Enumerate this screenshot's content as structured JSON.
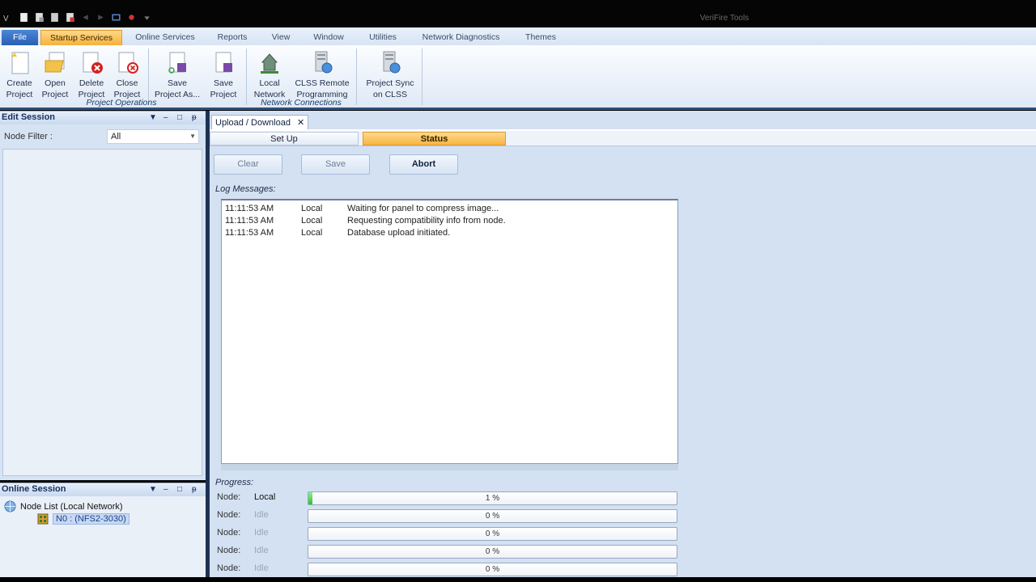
{
  "window": {
    "title": "VeriFire Tools"
  },
  "quick_access": [
    "app-logo-icon",
    "new-file-icon",
    "open-file-icon",
    "save-file-icon",
    "print-icon",
    "undo-icon",
    "redo-icon",
    "network-icon",
    "run-icon",
    "customize-icon"
  ],
  "ribbon_tabs": [
    {
      "label": "File",
      "active": false
    },
    {
      "label": "Startup Services",
      "active": true
    },
    {
      "label": "Online Services",
      "active": false
    },
    {
      "label": "Reports",
      "active": false
    },
    {
      "label": "View",
      "active": false
    },
    {
      "label": "Window",
      "active": false
    },
    {
      "label": "Utilities",
      "active": false
    },
    {
      "label": "Network Diagnostics",
      "active": false
    },
    {
      "label": "Themes",
      "active": false
    }
  ],
  "ribbon": {
    "groups": {
      "project_operations": "Project Operations",
      "network_connections": "Network Connections"
    },
    "buttons": {
      "create": [
        "Create",
        "Project"
      ],
      "open": [
        "Open",
        "Project"
      ],
      "delete": [
        "Delete",
        "Project"
      ],
      "close": [
        "Close",
        "Project"
      ],
      "save_as": [
        "Save",
        "Project As..."
      ],
      "save": [
        "Save",
        "Project"
      ],
      "local_network": [
        "Local",
        "Network"
      ],
      "clss_remote": [
        "CLSS Remote",
        "Programming"
      ],
      "project_sync": [
        "Project Sync",
        "on CLSS"
      ]
    }
  },
  "edit_session": {
    "title": "Edit Session",
    "node_filter_label": "Node Filter :",
    "node_filter_value": "All"
  },
  "online_session": {
    "title": "Online Session",
    "tree_root": "Node List (Local Network)",
    "tree_child": "N0 : (NFS2-3030)"
  },
  "document": {
    "tab_label": "Upload / Download",
    "subtabs": {
      "setup": "Set Up",
      "status": "Status"
    },
    "buttons": {
      "clear": "Clear",
      "save": "Save",
      "abort": "Abort"
    },
    "log_label": "Log Messages:",
    "log": [
      {
        "time": "11:11:53 AM",
        "source": "Local",
        "message": "Waiting for panel to compress image..."
      },
      {
        "time": "11:11:53 AM",
        "source": "Local",
        "message": "Requesting compatibility info from node."
      },
      {
        "time": "11:11:53 AM",
        "source": "Local",
        "message": "Database upload initiated."
      }
    ],
    "progress_label": "Progress:",
    "progress": [
      {
        "label": "Node:",
        "value": "Local",
        "percent": 1,
        "text": "1 %",
        "idle": false
      },
      {
        "label": "Node:",
        "value": "Idle",
        "percent": 0,
        "text": "0 %",
        "idle": true
      },
      {
        "label": "Node:",
        "value": "Idle",
        "percent": 0,
        "text": "0 %",
        "idle": true
      },
      {
        "label": "Node:",
        "value": "Idle",
        "percent": 0,
        "text": "0 %",
        "idle": true
      },
      {
        "label": "Node:",
        "value": "Idle",
        "percent": 0,
        "text": "0 %",
        "idle": true
      }
    ]
  },
  "colors": {
    "active_tab": "#f6b13b",
    "file_tab": "#2a5fb4",
    "progress_fill": "#2fbf2f",
    "accent_dark": "#1d3153"
  }
}
